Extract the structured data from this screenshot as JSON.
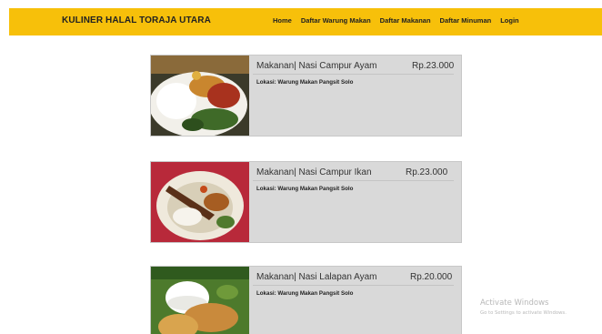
{
  "header": {
    "brand": "KULINER HALAL TORAJA UTARA",
    "nav": [
      "Home",
      "Daftar Warung Makan",
      "Daftar Makanan",
      "Daftar Minuman",
      "Login"
    ]
  },
  "items": [
    {
      "title": "Makanan| Nasi Campur Ayam",
      "price": "Rp.23.000",
      "location": "Lokasi: Warung Makan Pangsit Solo",
      "image": "nasi-campur-ayam-photo"
    },
    {
      "title": "Makanan| Nasi Campur Ikan",
      "price": "Rp.23.000",
      "location": "Lokasi: Warung Makan Pangsit Solo",
      "image": "nasi-campur-ikan-photo"
    },
    {
      "title": "Makanan| Nasi Lalapan Ayam",
      "price": "Rp.20.000",
      "location": "Lokasi: Warung Makan Pangsit Solo",
      "image": "nasi-lalapan-ayam-photo"
    }
  ],
  "watermark": {
    "line1": "Activate Windows",
    "line2": "Go to Settings to activate Windows."
  },
  "colors": {
    "navbar": "#f7c00a",
    "card": "#d9d9d9"
  }
}
